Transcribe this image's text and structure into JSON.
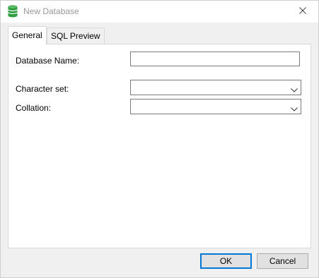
{
  "window": {
    "title": "New Database",
    "app_icon": "database-icon",
    "close_icon": "close-icon"
  },
  "tabs": [
    {
      "label": "General",
      "active": true
    },
    {
      "label": "SQL Preview",
      "active": false
    }
  ],
  "form": {
    "database_name_label": "Database Name:",
    "database_name_value": "",
    "character_set_label": "Character set:",
    "character_set_value": "",
    "collation_label": "Collation:",
    "collation_value": ""
  },
  "buttons": {
    "ok_label": "OK",
    "cancel_label": "Cancel"
  },
  "colors": {
    "accent": "#0078d7",
    "icon_green": "#2e9e3e"
  }
}
